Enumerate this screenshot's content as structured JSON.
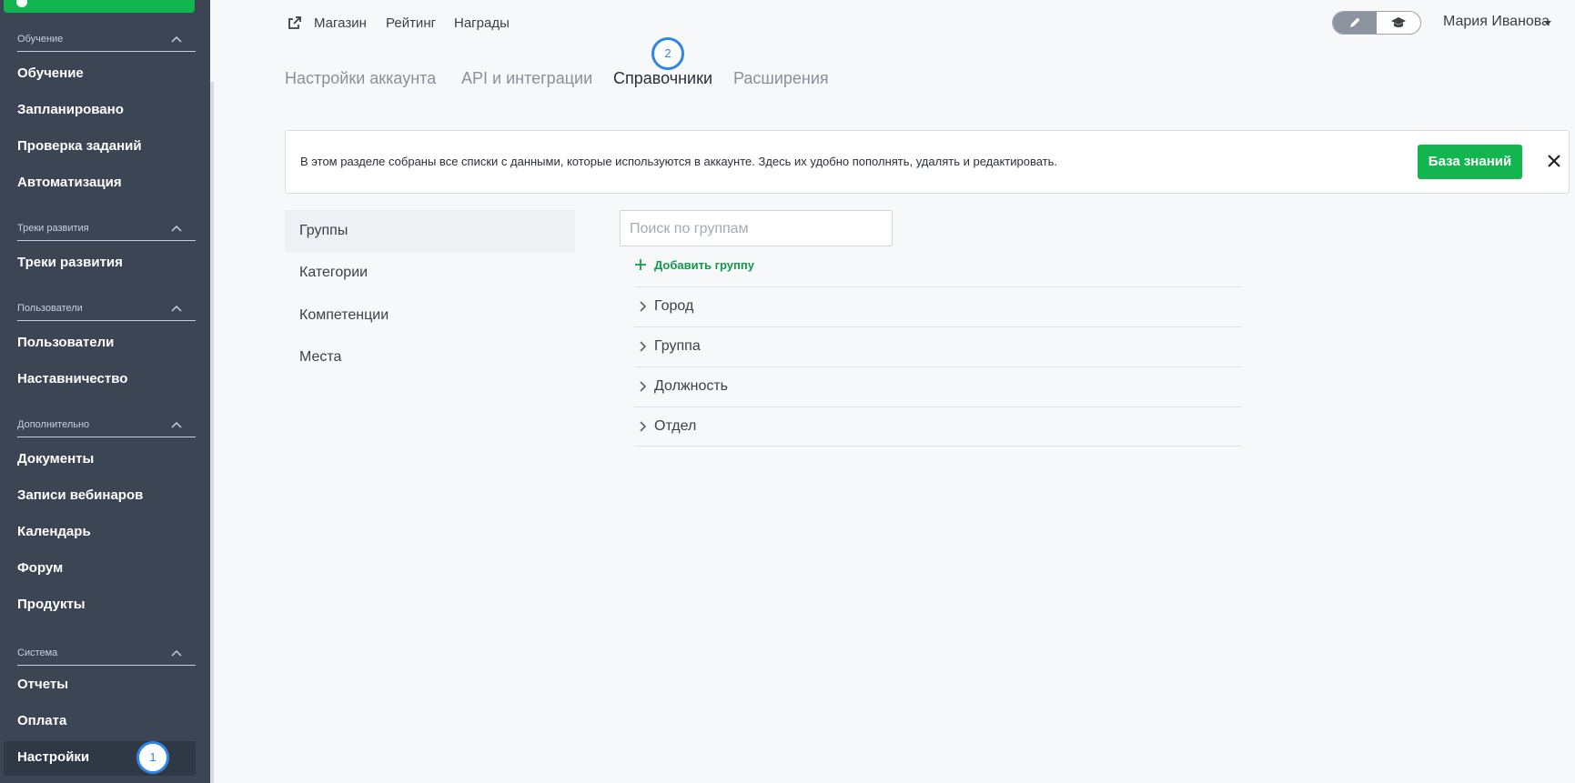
{
  "sidebar": {
    "sections": [
      {
        "title": "Обучение",
        "items": [
          "Обучение",
          "Запланировано",
          "Проверка заданий",
          "Автоматизация"
        ]
      },
      {
        "title": "Треки развития",
        "items": [
          "Треки развития"
        ]
      },
      {
        "title": "Пользователи",
        "items": [
          "Пользователи",
          "Наставничество"
        ]
      },
      {
        "title": "Дополнительно",
        "items": [
          "Документы",
          "Записи вебинаров",
          "Календарь",
          "Форум",
          "Продукты"
        ]
      },
      {
        "title": "Система",
        "items": [
          "Отчеты",
          "Оплата",
          "Настройки"
        ]
      }
    ],
    "active_item": "Настройки"
  },
  "badges": {
    "step1": "1",
    "step2": "2"
  },
  "topnav": {
    "items": [
      "Магазин",
      "Рейтинг",
      "Награды"
    ]
  },
  "tabs": {
    "items": [
      "Настройки аккаунта",
      "API и интеграции",
      "Справочники",
      "Расширения"
    ],
    "active": "Справочники"
  },
  "user": {
    "name": "Мария Иванова"
  },
  "info": {
    "text": "В этом разделе собраны все списки с данными, которые используются в аккаунте. Здесь их удобно пополнять, удалять и редактировать.",
    "button_label": "База знаний"
  },
  "directories": {
    "items": [
      "Группы",
      "Категории",
      "Компетенции",
      "Места"
    ],
    "active": "Группы"
  },
  "search": {
    "placeholder": "Поиск по группам",
    "value": ""
  },
  "add_group_label": "Добавить группу",
  "groups": [
    "Город",
    "Группа",
    "Должность",
    "Отдел"
  ],
  "colors": {
    "accent_green": "#12b54f",
    "sidebar_bg": "#3b4554",
    "badge_blue": "#2f86e6"
  }
}
